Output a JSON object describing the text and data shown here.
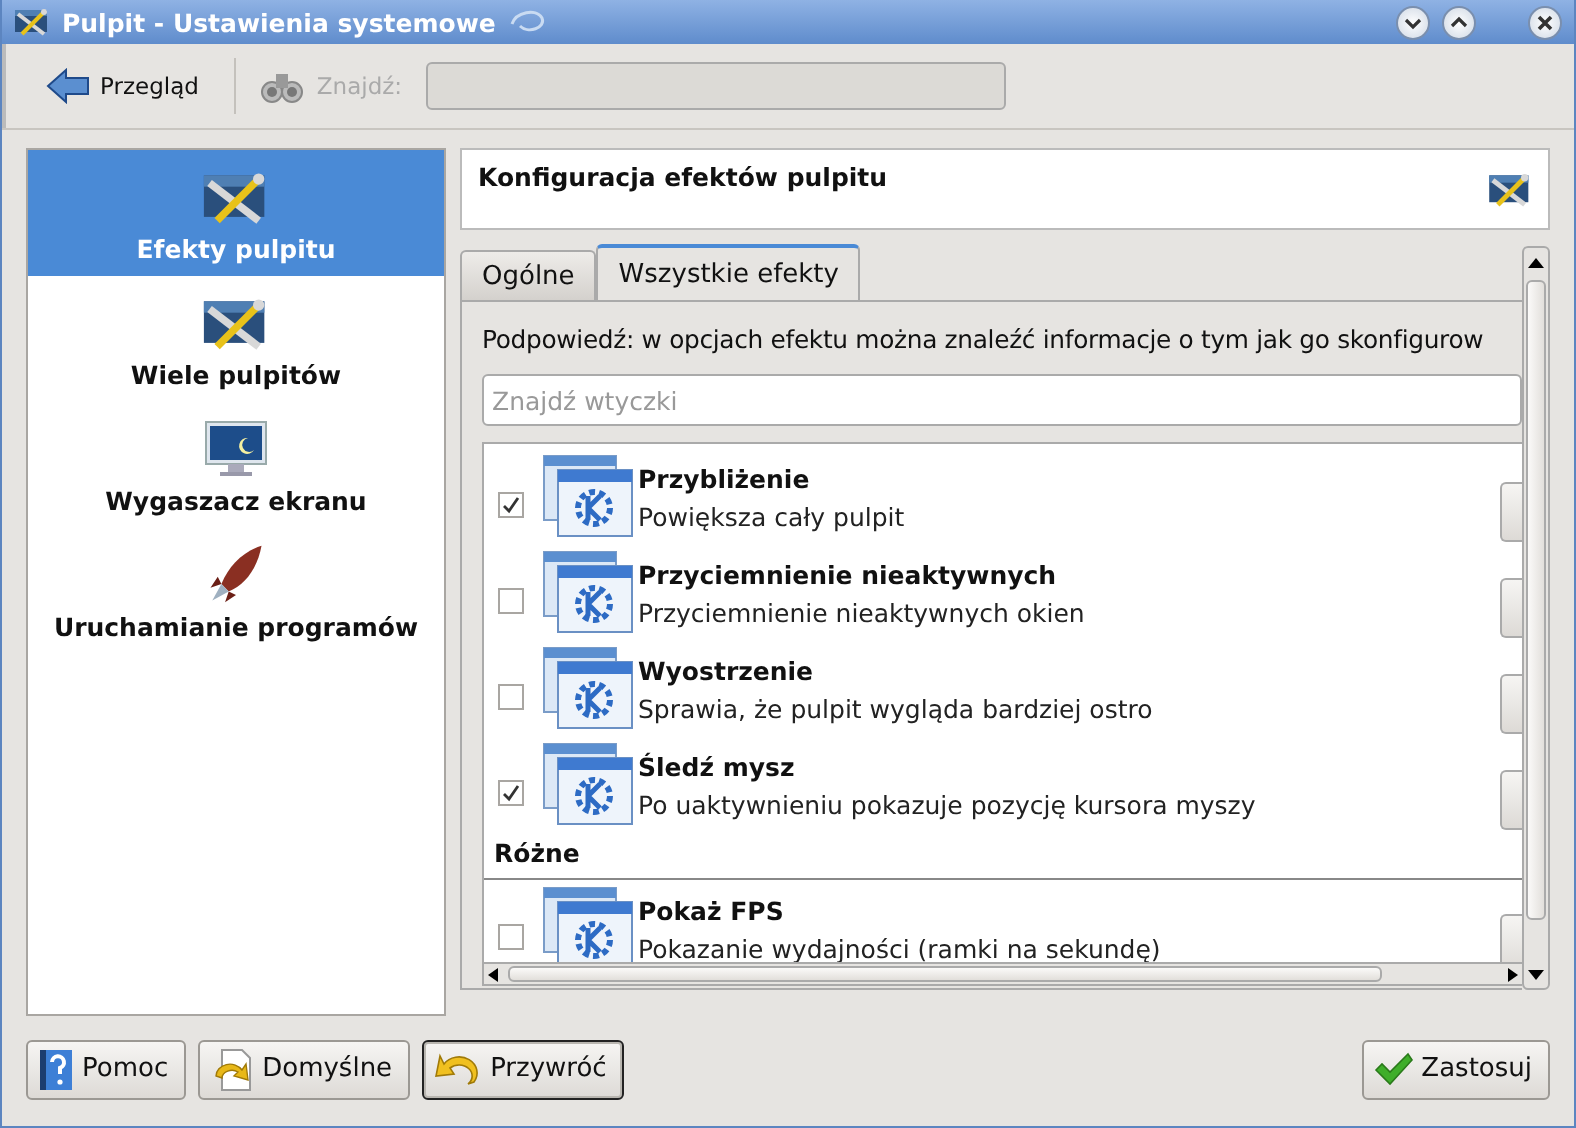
{
  "window": {
    "title": "Pulpit - Ustawienia systemowe"
  },
  "toolbar": {
    "overview_button": "Przegląd",
    "search": {
      "label": "Znajdź:",
      "disabled": true
    }
  },
  "sidebar": {
    "items": [
      {
        "label": "Efekty pulpitu",
        "kind": "effects",
        "selected": true
      },
      {
        "label": "Wiele pulpitów",
        "kind": "effects",
        "selected": false
      },
      {
        "label": "Wygaszacz ekranu",
        "kind": "screensaver",
        "selected": false
      },
      {
        "label": "Uruchamianie programów",
        "kind": "launch",
        "selected": false
      }
    ]
  },
  "panel": {
    "title": "Konfiguracja efektów pulpitu"
  },
  "tabs": [
    {
      "label": "Ogólne",
      "selected": false
    },
    {
      "label": "Wszystkie efekty",
      "selected": true
    }
  ],
  "hint": "Podpowiedź: w opcjach efektu można znaleźć informacje o tym jak go skonfigurow",
  "filter": {
    "placeholder": "Znajdź wtyczki"
  },
  "effects": [
    {
      "kind": "effect",
      "name": "Przybliżenie",
      "description": "Powiększa cały pulpit",
      "checked": true
    },
    {
      "kind": "effect",
      "name": "Przyciemnienie nieaktywnych",
      "description": "Przyciemnienie nieaktywnych okien",
      "checked": false
    },
    {
      "kind": "effect",
      "name": "Wyostrzenie",
      "description": "Sprawia, że pulpit wygląda bardziej ostro",
      "checked": false
    },
    {
      "kind": "effect",
      "name": "Śledź mysz",
      "description": "Po uaktywnieniu pokazuje pozycję kursora myszy",
      "checked": true
    },
    {
      "kind": "group",
      "name": "Różne"
    },
    {
      "kind": "effect",
      "name": "Pokaż FPS",
      "description": "Pokazanie wydajności (ramki na sekundę)",
      "checked": false
    }
  ],
  "buttons": [
    {
      "label": "Pomoc",
      "kind": "help",
      "focused": false
    },
    {
      "label": "Domyślne",
      "kind": "defaults",
      "focused": false
    },
    {
      "label": "Przywróć",
      "kind": "reset",
      "focused": true
    },
    {
      "label": "Zastosuj",
      "kind": "apply",
      "focused": false
    }
  ]
}
